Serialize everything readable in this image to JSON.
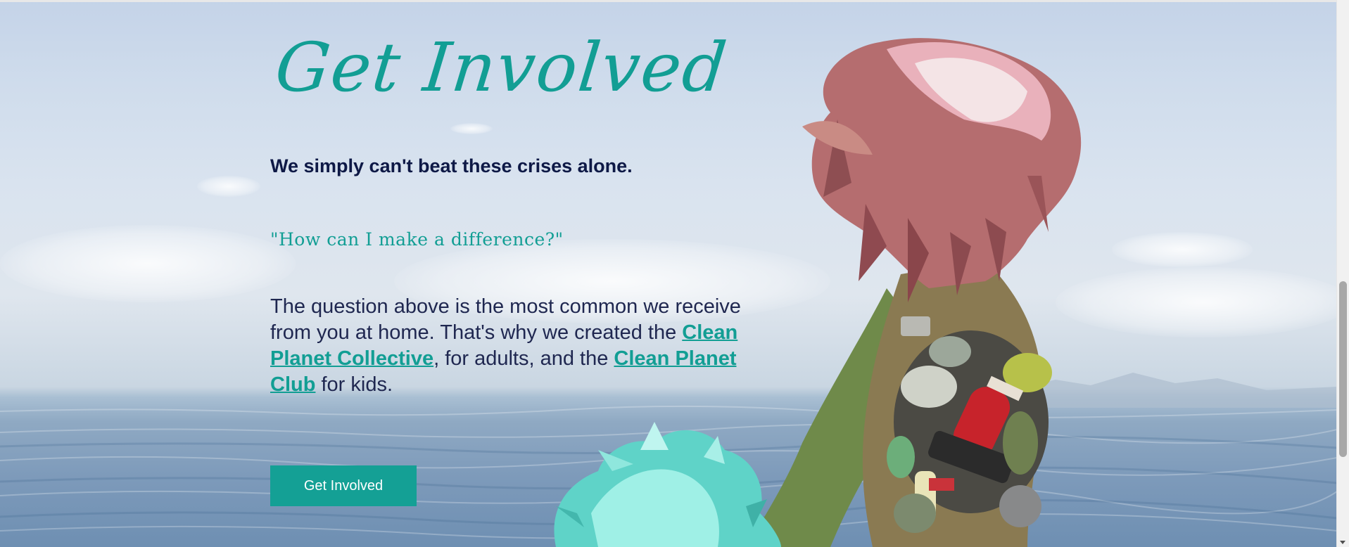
{
  "hero": {
    "title": "Get Involved",
    "subtitle": "We simply can't beat these crises alone.",
    "question": "\"How can I make a difference?\"",
    "paragraph": {
      "part1": "The question above is the most common we receive from you at home. That's why we created the ",
      "link1": "Clean Planet Collective",
      "part2": ", for adults, and the ",
      "link2": "Clean Planet Club",
      "part3": " for kids."
    },
    "button_label": "Get Involved"
  },
  "colors": {
    "accent": "#129e94",
    "heading_dark": "#0e1946",
    "button_bg": "#14a095"
  },
  "icons": {
    "scroll_down": "chevron-down-icon"
  }
}
